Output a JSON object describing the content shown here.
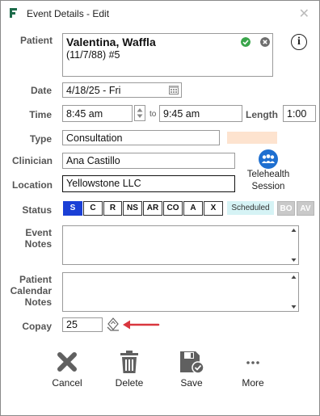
{
  "window": {
    "title": "Event Details - Edit"
  },
  "labels": {
    "patient": "Patient",
    "date": "Date",
    "time": "Time",
    "length": "Length",
    "type": "Type",
    "clinician": "Clinician",
    "location": "Location",
    "status": "Status",
    "event_notes_1": "Event",
    "event_notes_2": "Notes",
    "pcn_1": "Patient",
    "pcn_2": "Calendar",
    "pcn_3": "Notes",
    "copay": "Copay",
    "to": "to"
  },
  "patient": {
    "name": "Valentina, Waffla",
    "info": "(11/7/88) #5"
  },
  "date": {
    "value": "4/18/25 - Fri"
  },
  "time": {
    "start": "8:45 am",
    "end": "9:45 am",
    "length": "1:00"
  },
  "type": {
    "value": "Consultation",
    "swatch_color": "#fde3cf"
  },
  "clinician": {
    "value": "Ana Castillo"
  },
  "location": {
    "value": "Yellowstone LLC"
  },
  "telehealth": {
    "label_1": "Telehealth",
    "label_2": "Session",
    "color": "#1e6fd0"
  },
  "status": {
    "buttons": [
      "S",
      "C",
      "R",
      "NS",
      "AR",
      "CO",
      "A",
      "X"
    ],
    "selected_color": "#1a3fd6",
    "state_text": "Scheduled",
    "extra": [
      "BO",
      "AV"
    ]
  },
  "copay": {
    "value": "25"
  },
  "actions": {
    "cancel": "Cancel",
    "delete": "Delete",
    "save": "Save",
    "more": "More"
  },
  "icon_names": [
    "close-icon",
    "check-icon",
    "remove-icon",
    "info-icon",
    "calendar-icon",
    "telehealth-icon",
    "payment-icon",
    "arrow-icon",
    "trash-icon",
    "save-icon",
    "more-icon"
  ]
}
